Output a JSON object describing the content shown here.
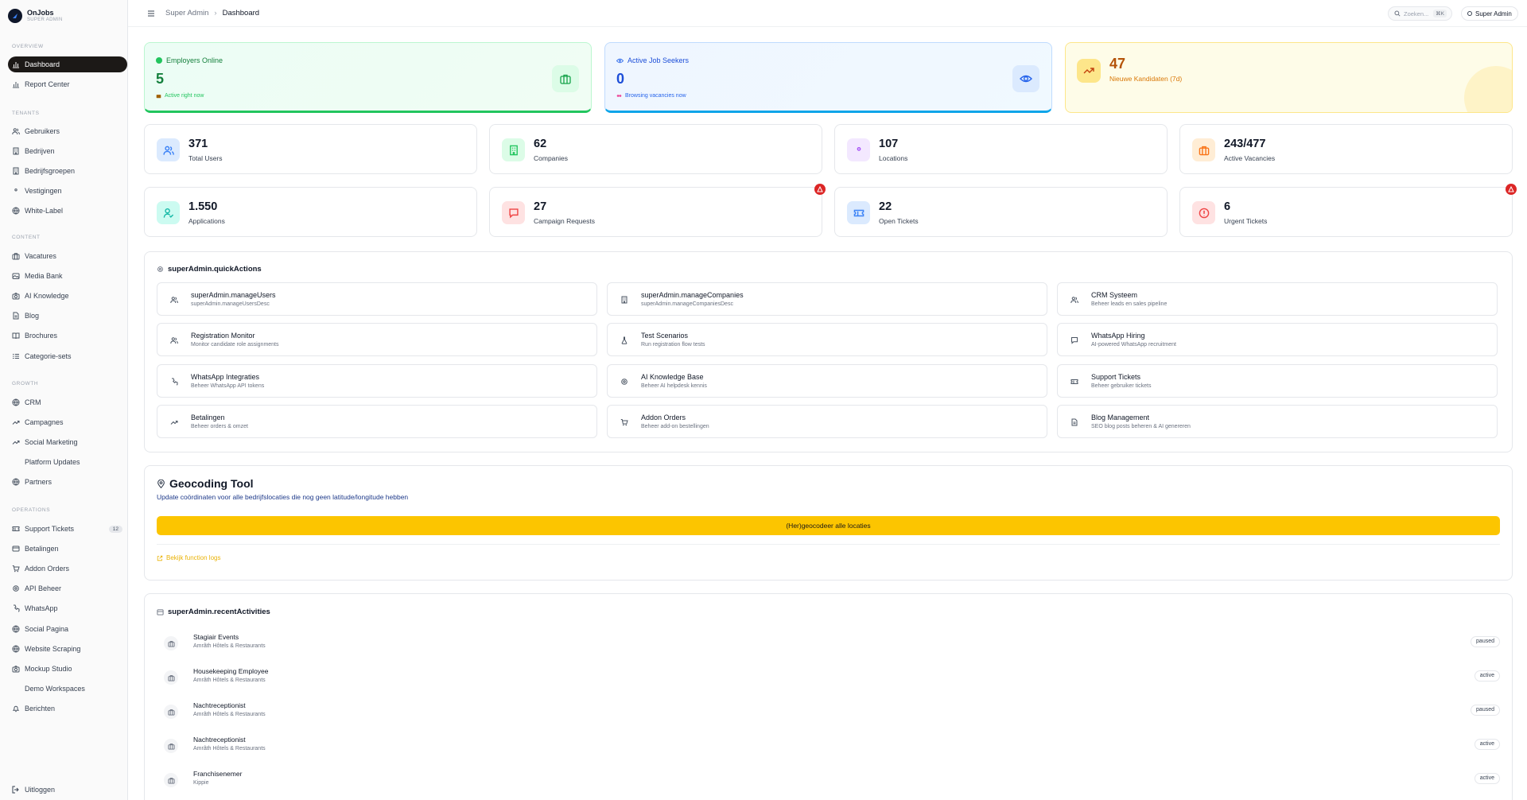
{
  "brand": {
    "name": "OnJobs",
    "subtitle": "SUPER ADMIN"
  },
  "sidebar": {
    "sections": [
      {
        "title": "OVERVIEW",
        "items": [
          {
            "label": "Dashboard",
            "icon": "bar-chart-icon",
            "active": true
          },
          {
            "label": "Report Center",
            "icon": "bar-chart-icon"
          }
        ]
      },
      {
        "title": "TENANTS",
        "items": [
          {
            "label": "Gebruikers",
            "icon": "users-icon"
          },
          {
            "label": "Bedrijven",
            "icon": "building-icon"
          },
          {
            "label": "Bedrijfsgroepen",
            "icon": "building-icon"
          },
          {
            "label": "Vestigingen",
            "icon": "map-pin-icon"
          },
          {
            "label": "White-Label",
            "icon": "globe-icon"
          }
        ]
      },
      {
        "title": "CONTENT",
        "items": [
          {
            "label": "Vacatures",
            "icon": "briefcase-icon"
          },
          {
            "label": "Media Bank",
            "icon": "image-icon"
          },
          {
            "label": "AI Knowledge",
            "icon": "camera-icon"
          },
          {
            "label": "Blog",
            "icon": "file-icon"
          },
          {
            "label": "Brochures",
            "icon": "book-icon"
          },
          {
            "label": "Categorie-sets",
            "icon": "list-icon"
          }
        ]
      },
      {
        "title": "GROWTH",
        "items": [
          {
            "label": "CRM",
            "icon": "globe-icon"
          },
          {
            "label": "Campagnes",
            "icon": "trending-icon"
          },
          {
            "label": "Social Marketing",
            "icon": "trending-icon"
          },
          {
            "label": "Platform Updates",
            "icon": "rocket-icon"
          },
          {
            "label": "Partners",
            "icon": "globe-icon"
          }
        ]
      },
      {
        "title": "OPERATIONS",
        "items": [
          {
            "label": "Support Tickets",
            "icon": "ticket-icon",
            "badge": "12"
          },
          {
            "label": "Betalingen",
            "icon": "card-icon"
          },
          {
            "label": "Addon Orders",
            "icon": "cart-icon"
          },
          {
            "label": "API Beheer",
            "icon": "gear-icon"
          },
          {
            "label": "WhatsApp",
            "icon": "phone-icon"
          },
          {
            "label": "Social Pagina",
            "icon": "globe-icon"
          },
          {
            "label": "Website Scraping",
            "icon": "globe-icon"
          },
          {
            "label": "Mockup Studio",
            "icon": "camera-icon"
          },
          {
            "label": "Demo Workspaces",
            "icon": "rocket-icon"
          },
          {
            "label": "Berichten",
            "icon": "bell-icon"
          }
        ]
      }
    ],
    "logout": "Uitloggen"
  },
  "topbar": {
    "breadcrumb_root": "Super Admin",
    "breadcrumb_sep": "›",
    "breadcrumb_current": "Dashboard",
    "search_placeholder": "Zoeken...",
    "search_shortcut": "⌘K",
    "user_label": "Super Admin"
  },
  "hero": {
    "employers": {
      "label": "Employers Online",
      "value": "5",
      "sub": "Active right now"
    },
    "seekers": {
      "label": "Active Job Seekers",
      "value": "0",
      "sub": "Browsing vacancies now"
    },
    "candidates": {
      "value": "47",
      "label": "Nieuwe Kandidaten (7d)"
    }
  },
  "stats": [
    {
      "value": "371",
      "label": "Total Users",
      "icon": "users-icon",
      "color": "#3b82f6",
      "bg": "#dbeafe"
    },
    {
      "value": "62",
      "label": "Companies",
      "icon": "building-icon",
      "color": "#22c55e",
      "bg": "#dcfce7"
    },
    {
      "value": "107",
      "label": "Locations",
      "icon": "map-pin-icon",
      "color": "#a855f7",
      "bg": "#f3e8ff"
    },
    {
      "value": "243/477",
      "label": "Active Vacancies",
      "icon": "briefcase-icon",
      "color": "#f97316",
      "bg": "#ffedd5"
    },
    {
      "value": "1.550",
      "label": "Applications",
      "icon": "user-check-icon",
      "color": "#14b8a6",
      "bg": "#ccfbf1"
    },
    {
      "value": "27",
      "label": "Campaign Requests",
      "icon": "message-icon",
      "color": "#ef4444",
      "bg": "#fee2e2"
    },
    {
      "value": "22",
      "label": "Open Tickets",
      "icon": "ticket-icon",
      "color": "#3b82f6",
      "bg": "#dbeafe"
    },
    {
      "value": "6",
      "label": "Urgent Tickets",
      "icon": "alert-circle-icon",
      "color": "#ef4444",
      "bg": "#fee2e2"
    }
  ],
  "quick_actions": {
    "title": "superAdmin.quickActions",
    "items": [
      {
        "title": "superAdmin.manageUsers",
        "desc": "superAdmin.manageUsersDesc",
        "icon": "users-icon"
      },
      {
        "title": "superAdmin.manageCompanies",
        "desc": "superAdmin.manageCompaniesDesc",
        "icon": "building-icon"
      },
      {
        "title": "CRM Systeem",
        "desc": "Beheer leads en sales pipeline",
        "icon": "users-icon"
      },
      {
        "title": "Registration Monitor",
        "desc": "Monitor candidate role assignments",
        "icon": "users-icon"
      },
      {
        "title": "Test Scenarios",
        "desc": "Run registration flow tests",
        "icon": "flask-icon"
      },
      {
        "title": "WhatsApp Hiring",
        "desc": "AI-powered WhatsApp recruitment",
        "icon": "message-icon"
      },
      {
        "title": "WhatsApp Integraties",
        "desc": "Beheer WhatsApp API tokens",
        "icon": "phone-icon"
      },
      {
        "title": "AI Knowledge Base",
        "desc": "Beheer AI helpdesk kennis",
        "icon": "gear-icon"
      },
      {
        "title": "Support Tickets",
        "desc": "Beheer gebruiker tickets",
        "icon": "ticket-icon"
      },
      {
        "title": "Betalingen",
        "desc": "Beheer orders & omzet",
        "icon": "trending-icon"
      },
      {
        "title": "Addon Orders",
        "desc": "Beheer add-on bestellingen",
        "icon": "cart-icon"
      },
      {
        "title": "Blog Management",
        "desc": "SEO blog posts beheren & AI genereren",
        "icon": "file-icon"
      }
    ]
  },
  "geocoding": {
    "title": "Geocoding Tool",
    "desc": "Update coördinaten voor alle bedrijfslocaties die nog geen latitude/longitude hebben",
    "button": "(Her)geocodeer alle locaties",
    "link": "Bekijk function logs"
  },
  "activities": {
    "title": "superAdmin.recentActivities",
    "items": [
      {
        "title": "Stagiair Events",
        "desc": "Amrâth Hôtels & Restaurants",
        "status": "paused"
      },
      {
        "title": "Housekeeping Employee",
        "desc": "Amrâth Hôtels & Restaurants",
        "status": "active"
      },
      {
        "title": "Nachtreceptionist",
        "desc": "Amrâth Hôtels & Restaurants",
        "status": "paused"
      },
      {
        "title": "Nachtreceptionist",
        "desc": "Amrâth Hôtels & Restaurants",
        "status": "active"
      },
      {
        "title": "Franchisenemer",
        "desc": "Kippie",
        "status": "active"
      }
    ]
  }
}
